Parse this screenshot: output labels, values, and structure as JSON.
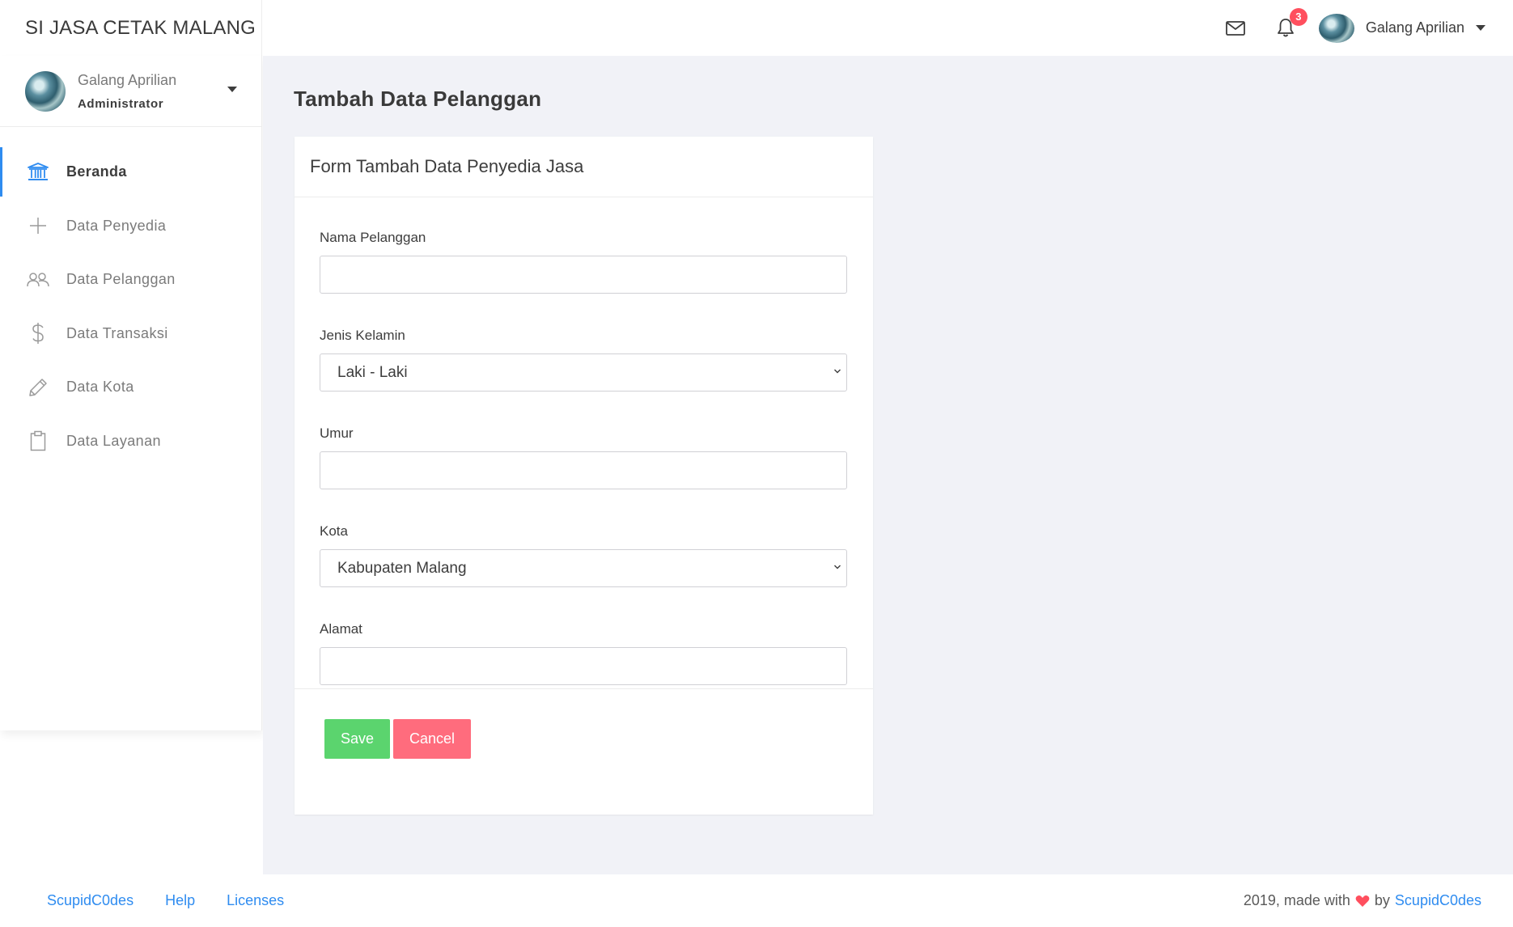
{
  "app": {
    "brand": "SI JASA CETAK MALANG"
  },
  "topbar": {
    "notification_count": "3",
    "user_name": "Galang Aprilian",
    "icons": [
      "mail-icon",
      "bell-icon",
      "caret-down-icon"
    ]
  },
  "sidebar": {
    "profile": {
      "name": "Galang Aprilian",
      "role": "Administrator"
    },
    "items": [
      {
        "label": "Beranda",
        "icon": "bank-icon",
        "active": true
      },
      {
        "label": "Data Penyedia",
        "icon": "plus-icon",
        "active": false
      },
      {
        "label": "Data Pelanggan",
        "icon": "users-icon",
        "active": false
      },
      {
        "label": "Data Transaksi",
        "icon": "dollar-icon",
        "active": false
      },
      {
        "label": "Data Kota",
        "icon": "pencil-icon",
        "active": false
      },
      {
        "label": "Data Layanan",
        "icon": "clipboard-icon",
        "active": false
      }
    ]
  },
  "main": {
    "page_title": "Tambah Data Pelanggan",
    "card_title": "Form Tambah Data Penyedia Jasa",
    "form": {
      "nama_label": "Nama Pelanggan",
      "nama_value": "",
      "jenis_label": "Jenis Kelamin",
      "jenis_value": "Laki - Laki",
      "umur_label": "Umur",
      "umur_value": "",
      "kota_label": "Kota",
      "kota_value": "Kabupaten Malang",
      "alamat_label": "Alamat",
      "alamat_value": ""
    },
    "buttons": {
      "save": "Save",
      "cancel": "Cancel"
    }
  },
  "footer": {
    "links": [
      "ScupidC0des",
      "Help",
      "Licenses"
    ],
    "credit_prefix": "2019, made with",
    "credit_by": "by",
    "credit_brand": "ScupidC0des"
  },
  "colors": {
    "accent": "#2f8cf0",
    "save": "#5bd46e",
    "cancel": "#ff6c7d",
    "badge": "#ff4f5e",
    "background": "#f1f2f7"
  }
}
